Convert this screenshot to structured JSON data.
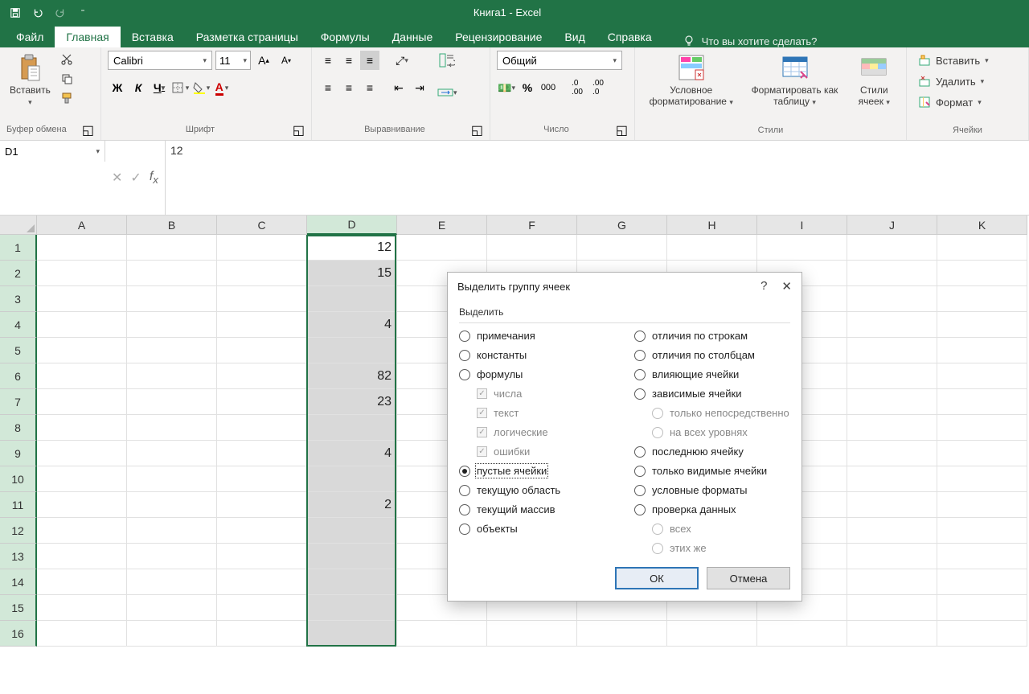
{
  "title": "Книга1  -  Excel",
  "tabs": {
    "file": "Файл",
    "home": "Главная",
    "insert": "Вставка",
    "layout": "Разметка страницы",
    "formulas": "Формулы",
    "data": "Данные",
    "review": "Рецензирование",
    "view": "Вид",
    "help": "Справка"
  },
  "tellme": "Что вы хотите сделать?",
  "groups": {
    "clipboard": {
      "paste": "Вставить",
      "label": "Буфер обмена"
    },
    "font": {
      "name": "Calibri",
      "size": "11",
      "label": "Шрифт",
      "bold": "Ж",
      "italic": "К",
      "underline": "Ч"
    },
    "alignment": {
      "label": "Выравнивание"
    },
    "number": {
      "format": "Общий",
      "label": "Число"
    },
    "styles": {
      "cond": "Условное форматирование",
      "table": "Форматировать как таблицу",
      "cell": "Стили ячеек",
      "label": "Стили"
    },
    "cells": {
      "insert": "Вставить",
      "delete": "Удалить",
      "format": "Формат",
      "label": "Ячейки"
    }
  },
  "namebox": "D1",
  "formula": "12",
  "columns": [
    "A",
    "B",
    "C",
    "D",
    "E",
    "F",
    "G",
    "H",
    "I",
    "J",
    "K"
  ],
  "rowCount": 16,
  "selectedCol": 3,
  "cellData": {
    "1": "12",
    "2": "15",
    "4": "4",
    "6": "82",
    "7": "23",
    "9": "4",
    "11": "2"
  },
  "dialog": {
    "title": "Выделить группу ячеек",
    "groupLabel": "Выделить",
    "left": [
      {
        "key": "notes",
        "label": "примечания"
      },
      {
        "key": "constants",
        "label": "константы"
      },
      {
        "key": "formulas",
        "label": "формулы"
      },
      {
        "key": "sub-numbers",
        "label": "числа",
        "sub": true
      },
      {
        "key": "sub-text",
        "label": "текст",
        "sub": true
      },
      {
        "key": "sub-logical",
        "label": "логические",
        "sub": true
      },
      {
        "key": "sub-errors",
        "label": "ошибки",
        "sub": true
      },
      {
        "key": "blanks",
        "label": "пустые ячейки",
        "selected": true
      },
      {
        "key": "current-region",
        "label": "текущую область"
      },
      {
        "key": "current-array",
        "label": "текущий массив"
      },
      {
        "key": "objects",
        "label": "объекты"
      }
    ],
    "right": [
      {
        "key": "row-diff",
        "label": "отличия по строкам"
      },
      {
        "key": "col-diff",
        "label": "отличия по столбцам"
      },
      {
        "key": "precedents",
        "label": "влияющие ячейки"
      },
      {
        "key": "dependents",
        "label": "зависимые ячейки"
      },
      {
        "key": "sub-direct",
        "label": "только непосредственно",
        "sub": true,
        "subradio": true
      },
      {
        "key": "sub-all",
        "label": "на всех уровнях",
        "sub": true,
        "subradio": true
      },
      {
        "key": "lastcell",
        "label": "последнюю ячейку"
      },
      {
        "key": "visible",
        "label": "только видимые ячейки"
      },
      {
        "key": "condfmt",
        "label": "условные форматы"
      },
      {
        "key": "validation",
        "label": "проверка данных"
      },
      {
        "key": "sub-all2",
        "label": "всех",
        "sub": true,
        "subradio": true
      },
      {
        "key": "sub-same",
        "label": "этих же",
        "sub": true,
        "subradio": true
      }
    ],
    "ok": "ОК",
    "cancel": "Отмена"
  }
}
